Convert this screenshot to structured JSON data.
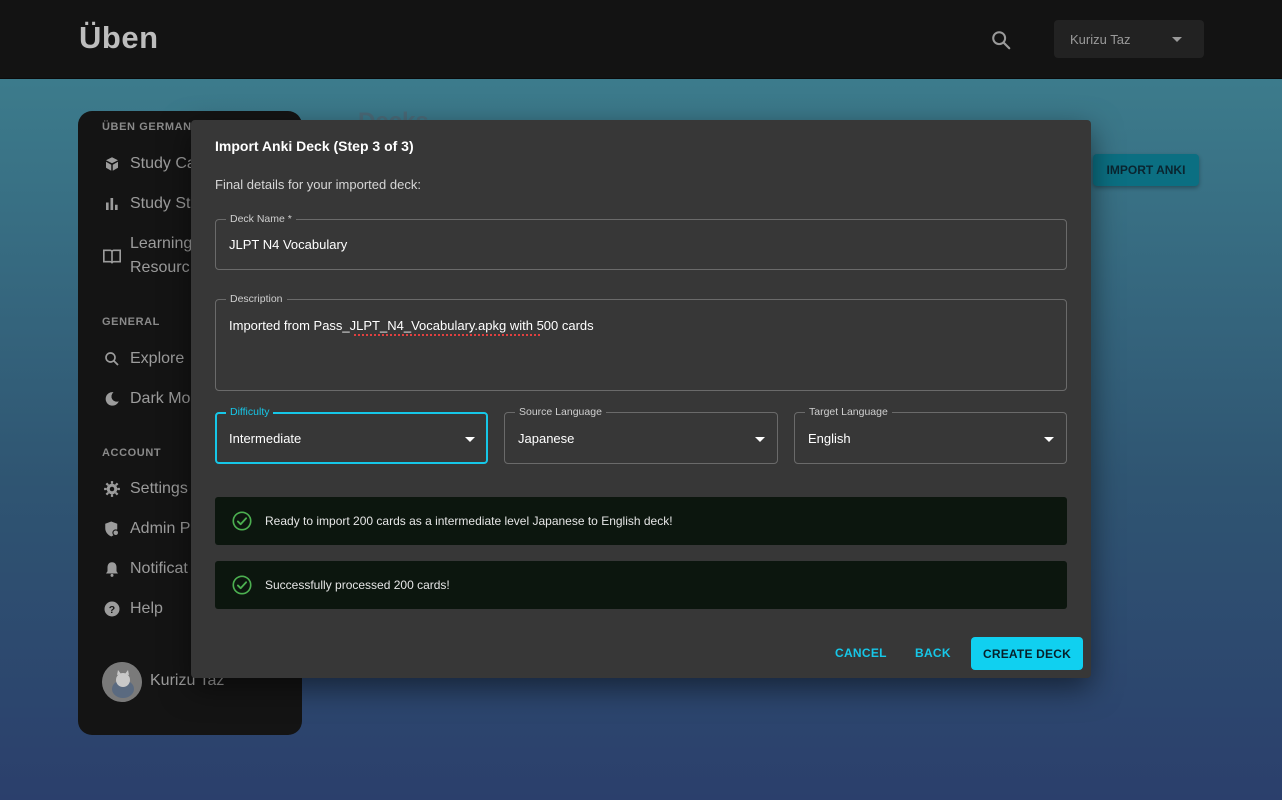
{
  "app": {
    "logo": "Üben",
    "user_menu": {
      "name": "Kurizu Taz"
    },
    "search_icon": "search-icon"
  },
  "sidebar": {
    "sections": [
      {
        "title": "ÜBEN GERMAN",
        "items": [
          {
            "label": "Study Ca",
            "icon": "cards-icon"
          },
          {
            "label": "Study St",
            "icon": "bar-chart-icon"
          },
          {
            "label": "Learning Resourc",
            "icon": "book-icon"
          }
        ]
      },
      {
        "title": "GENERAL",
        "items": [
          {
            "label": "Explore",
            "icon": "search-icon"
          },
          {
            "label": "Dark Mo",
            "icon": "moon-icon"
          }
        ]
      },
      {
        "title": "ACCOUNT",
        "items": [
          {
            "label": "Settings",
            "icon": "gear-icon"
          },
          {
            "label": "Admin P",
            "icon": "admin-shield-icon"
          },
          {
            "label": "Notificat",
            "icon": "bell-icon"
          },
          {
            "label": "Help",
            "icon": "help-icon"
          }
        ]
      }
    ],
    "learning_line1": "Learning",
    "learning_line2": "Resourc",
    "user_name": "Kurizu Taz"
  },
  "main": {
    "title": "Decks",
    "import_button": "IMPORT ANKI"
  },
  "dialog": {
    "title": "Import Anki Deck (Step 3 of 3)",
    "subtitle": "Final details for your imported deck:",
    "deck_name": {
      "label": "Deck Name *",
      "value": "JLPT N4 Vocabulary"
    },
    "description": {
      "label": "Description",
      "value": "Imported from Pass_JLPT_N4_Vocabulary.apkg with 500 cards"
    },
    "difficulty": {
      "label": "Difficulty",
      "value": "Intermediate"
    },
    "source_language": {
      "label": "Source Language",
      "value": "Japanese"
    },
    "target_language": {
      "label": "Target Language",
      "value": "English"
    },
    "alerts": [
      "Ready to import 200 cards as a intermediate level Japanese to English deck!",
      "Successfully processed 200 cards!"
    ],
    "buttons": {
      "cancel": "CANCEL",
      "back": "BACK",
      "create": "CREATE DECK"
    },
    "colors": {
      "accent": "#10d0f0",
      "success": "#4caf50"
    }
  }
}
